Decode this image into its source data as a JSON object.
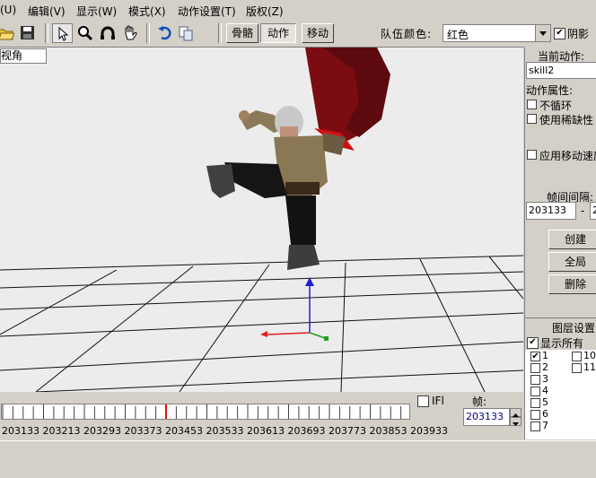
{
  "menu": [
    "(U)",
    "编辑(V)",
    "显示(W)",
    "模式(X)",
    "动作设置(T)",
    "版权(Z)"
  ],
  "toolbar": {
    "tabs": [
      "骨骼",
      "动作",
      "移动"
    ],
    "active_tab": "动作",
    "team_color_label": "队伍颜色:",
    "team_color_value": "红色",
    "shadow_label": "阴影",
    "shadow_checked": true
  },
  "viewport": {
    "view_label": "视角"
  },
  "right_panel": {
    "current_action_label": "当前动作:",
    "current_action_value": "skill2",
    "action_props_label": "动作属性:",
    "no_loop_label": "不循环",
    "use_sparse_label": "使用稀缺性",
    "apply_move_speed_label": "应用移动速度",
    "frame_interval_label": "帧间间隔:",
    "frame_start": "203133",
    "frame_dash": "-",
    "frame_end": "2",
    "create_button": "创建",
    "global_button": "全局",
    "delete_button": "删除",
    "layer_settings_label": "图层设置",
    "show_all_label": "显示所有",
    "show_all_checked": true,
    "layers_left": [
      {
        "label": "1",
        "checked": true
      },
      {
        "label": "2",
        "checked": false
      },
      {
        "label": "3",
        "checked": false
      },
      {
        "label": "4",
        "checked": false
      },
      {
        "label": "5",
        "checked": false
      },
      {
        "label": "6",
        "checked": false
      },
      {
        "label": "7",
        "checked": false
      }
    ],
    "layers_right": [
      {
        "label": "10",
        "checked": false
      },
      {
        "label": "11",
        "checked": false
      }
    ]
  },
  "timeline": {
    "ifl_label": "IFl",
    "frame_label": "帧:",
    "frame_value": "203133",
    "tick_labels": [
      "203133",
      "203213",
      "203293",
      "203373",
      "203453",
      "203533",
      "203613",
      "203693",
      "203773",
      "203853",
      "203933"
    ],
    "current_frame": 203453
  },
  "colors": {
    "axis_x": "#e02020",
    "axis_y": "#20a020",
    "axis_z": "#2020d0",
    "marker": "#e01010"
  }
}
